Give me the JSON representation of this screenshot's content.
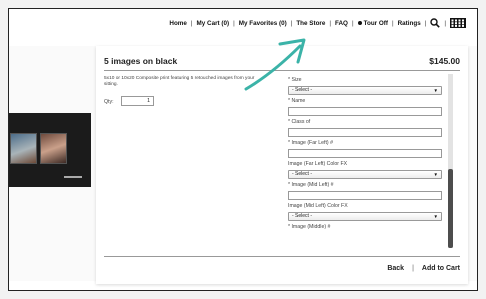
{
  "topnav": {
    "items": [
      {
        "label": "Home"
      },
      {
        "label": "My Cart (0)"
      },
      {
        "label": "My Favorites (0)"
      },
      {
        "label": "The Store"
      },
      {
        "label": "FAQ"
      },
      {
        "label": "Tour Off"
      },
      {
        "label": "Ratings"
      }
    ],
    "separator": "|"
  },
  "product": {
    "title": "5 images on black",
    "price": "$145.00",
    "description": "5x10 or 10x20 Composite print featuring 5 retouched images from your sitting.",
    "qty_label": "Qty:",
    "qty_value": "1"
  },
  "form": {
    "size_label": "* Size",
    "size_value": "- Select -",
    "name_label": "* Name",
    "class_label": "* Class of",
    "img_far_left_label": "* Image (Far Left) #",
    "img_far_left_fx_label": "Image (Far Left) Color FX",
    "img_far_left_fx_value": "- Select -",
    "img_mid_left_label": "* Image (Mid Left) #",
    "img_mid_left_fx_label": "Image (Mid Left) Color FX",
    "img_mid_left_fx_value": "- Select -",
    "img_middle_label": "* Image (Middle) #",
    "select_arrow": "▼"
  },
  "footer": {
    "back_label": "Back",
    "separator": "|",
    "add_to_cart_label": "Add to Cart"
  },
  "colors": {
    "annotation_arrow": "#3bb3a8",
    "scroll_thumb": "#4d4d4d"
  },
  "icons": [
    "search-icon",
    "grid-icon",
    "dot-icon",
    "arrow-icon"
  ]
}
